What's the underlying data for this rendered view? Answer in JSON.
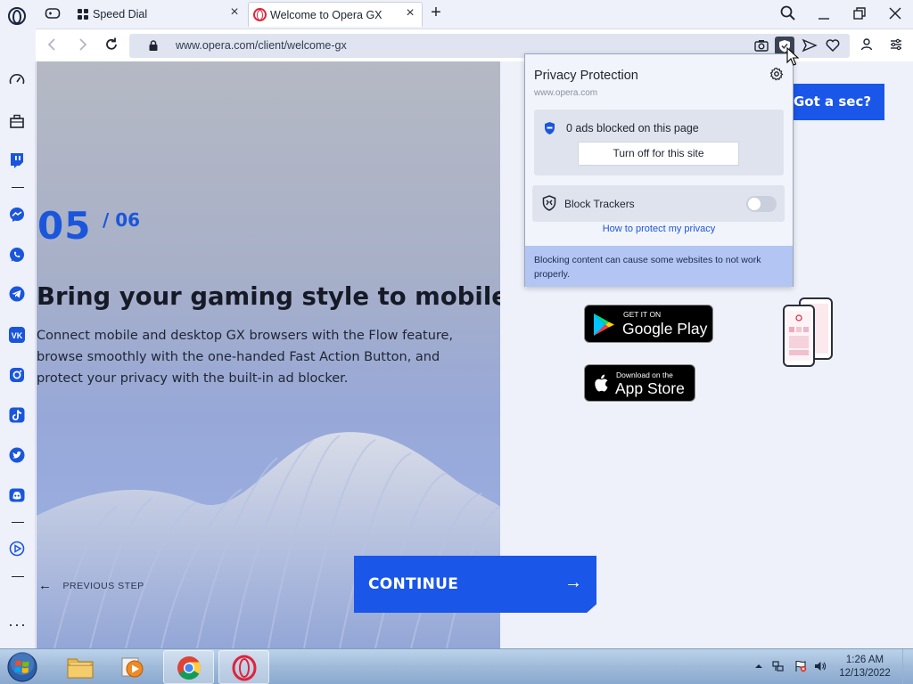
{
  "tabs": [
    {
      "label": "Speed Dial",
      "icon": "speed-dial-grid-icon"
    },
    {
      "label": "Welcome to Opera GX",
      "icon": "opera-icon",
      "active": true
    }
  ],
  "address": {
    "url": "www.opera.com/client/welcome-gx"
  },
  "page": {
    "step_number": "05",
    "step_total": "/ 06",
    "headline": "Bring your gaming style to mobile",
    "body": "Connect mobile and desktop GX browsers with the Flow feature, browse smoothly with the one-handed Fast Action Button, and protect your privacy with the built-in ad blocker.",
    "previous_step": "PREVIOUS STEP",
    "continue": "CONTINUE",
    "got_a_sec": "Got a sec?",
    "google_play_small": "GET IT ON",
    "google_play_big": "Google Play",
    "app_store_small": "Download on the",
    "app_store_big": "App Store"
  },
  "privacy_popup": {
    "title": "Privacy Protection",
    "domain": "www.opera.com",
    "ads_blocked": "0 ads blocked on this page",
    "turn_off": "Turn off for this site",
    "block_trackers": "Block Trackers",
    "block_trackers_enabled": false,
    "how_to": "How to protect my privacy",
    "warning": "Blocking content can cause some websites to not work properly."
  },
  "taskbar": {
    "time": "1:26 AM",
    "date": "12/13/2022"
  },
  "colors": {
    "accent_blue": "#1a56e8",
    "opera_red": "#e0233a",
    "popup_warning_bg": "#b3c5f2"
  }
}
